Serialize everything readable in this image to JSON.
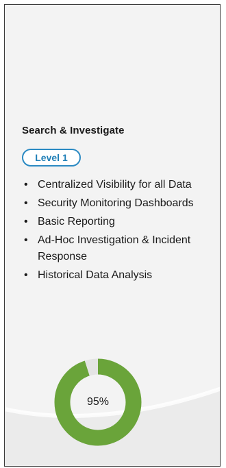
{
  "card": {
    "title": "Search & Investigate",
    "level_badge": "Level 1",
    "features": [
      "Centralized Visibility for all Data",
      "Security Monitoring Dashboards",
      "Basic Reporting",
      "Ad-Hoc Investigation & Incident Response",
      "Historical Data Analysis"
    ],
    "bullet_glyph": "•",
    "progress": {
      "value": 95,
      "label": "95%",
      "fill_color": "#6aa43a",
      "track_color": "#e4e4e4"
    }
  },
  "colors": {
    "badge_accent": "#2b8ac3",
    "card_background": "#f3f3f3"
  }
}
